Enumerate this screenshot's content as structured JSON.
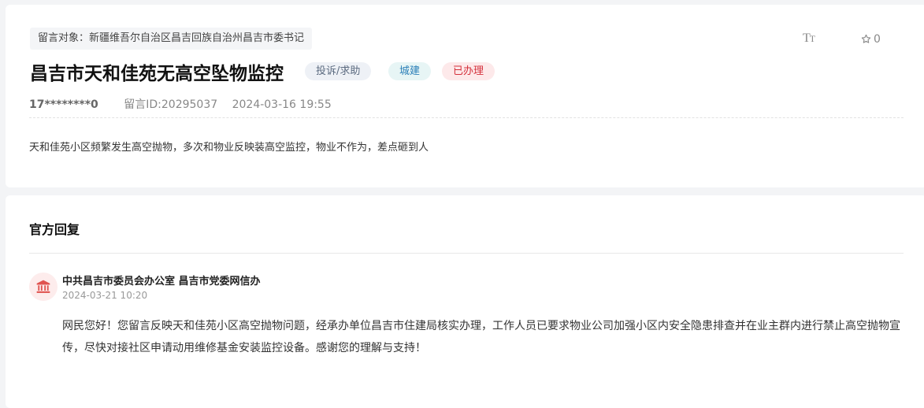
{
  "message": {
    "target_label": "留言对象：新疆维吾尔自治区昌吉回族自治州昌吉市委书记",
    "title": "昌吉市天和佳苑无高空坠物监控",
    "badges": {
      "type": "投诉/求助",
      "category": "城建",
      "status": "已办理"
    },
    "user": "17********0",
    "message_id": "留言ID:20295037",
    "datetime": "2024-03-16 19:55",
    "content": "天和佳苑小区频繁发生高空抛物，多次和物业反映装高空监控，物业不作为，差点砸到人",
    "favorite_count": "0",
    "font_size_icon": "text-size-icon"
  },
  "reply": {
    "heading": "官方回复",
    "org_icon": "government-building-icon",
    "org_name": "中共昌吉市委员会办公室 昌吉市党委网信办",
    "time": "2024-03-21 10:20",
    "body": "网民您好！您留言反映天和佳苑小区高空抛物问题，经承办单位昌吉市住建局核实办理，工作人员已要求物业公司加强小区内安全隐患排查并在业主群内进行禁止高空抛物宣传，尽快对接社区申请动用维修基金安装监控设备。感谢您的理解与支持！"
  },
  "colors": {
    "status_red": "#d4303b",
    "category_blue": "#2b7fb8",
    "avatar_red": "#e0534f"
  }
}
